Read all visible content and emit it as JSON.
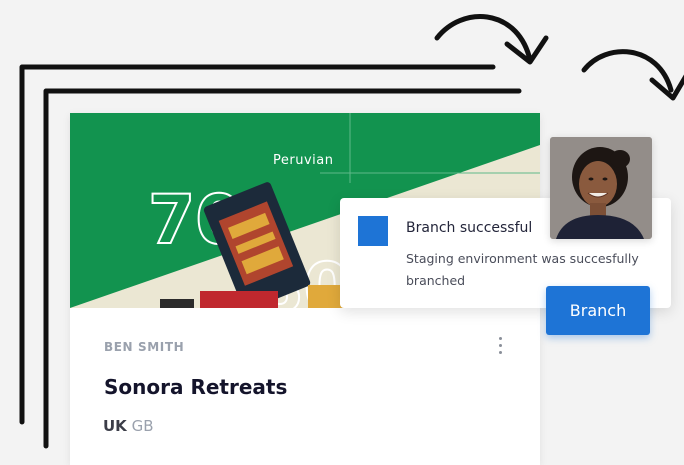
{
  "card": {
    "hero_label": "Peruvian",
    "hero_numbers": [
      "70",
      "80"
    ],
    "author": "BEN SMITH",
    "title": "Sonora Retreats",
    "country_code_strong": "UK",
    "country_code_light": "GB"
  },
  "toast": {
    "title": "Branch successful",
    "message": "Staging environment was succesfully branched"
  },
  "branch_button": {
    "label": "Branch"
  },
  "colors": {
    "accent_blue": "#1e74d6",
    "hero_green": "#12934f",
    "hero_cream": "#ebe7d3",
    "background": "#f3f3f3"
  },
  "icons": {
    "card_menu": "more-vertical-icon",
    "arrows": "curved-arrow-icon"
  }
}
